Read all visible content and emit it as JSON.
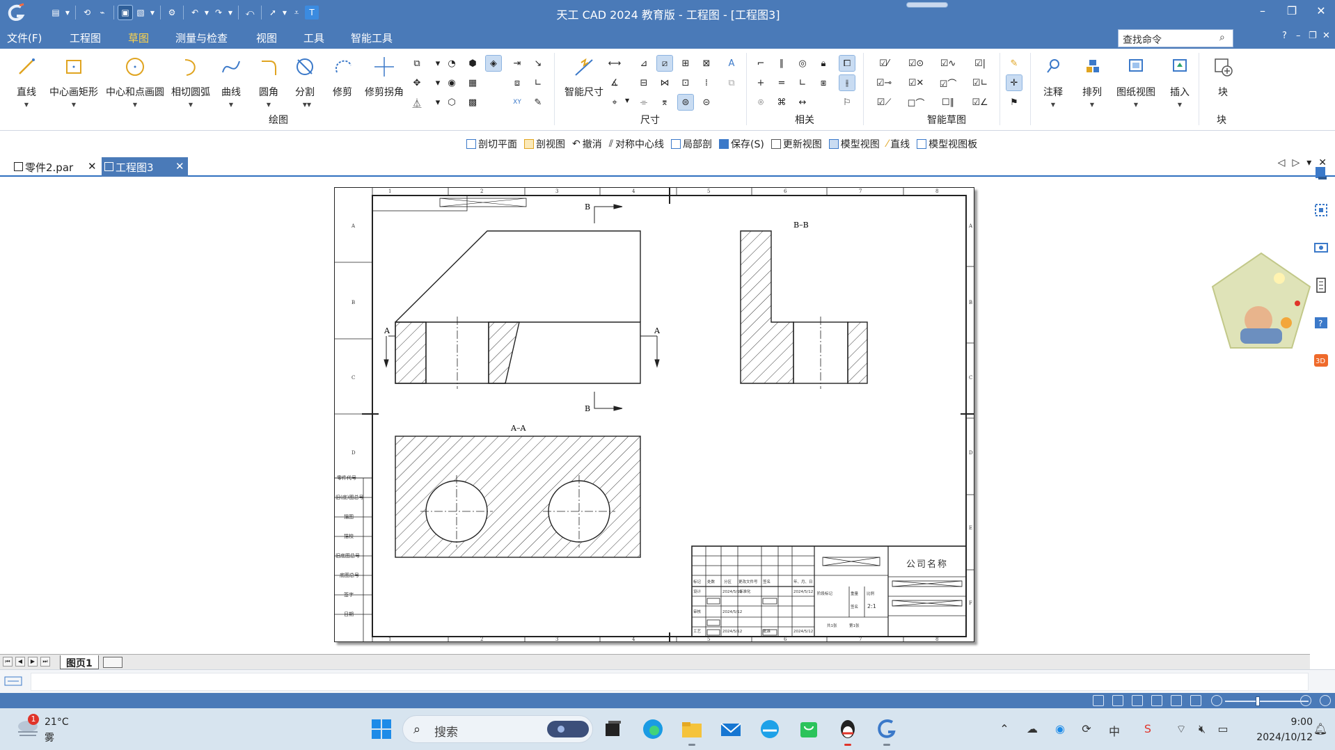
{
  "window": {
    "title": "天工 CAD 2024 教育版 - 工程图 - [工程图3]"
  },
  "menu": {
    "items": [
      "文件(F)",
      "工程图",
      "草图",
      "测量与检查",
      "视图",
      "工具",
      "智能工具"
    ],
    "active_index": 2,
    "search_placeholder": "查找命令",
    "help": "?"
  },
  "ribbon": {
    "draw_tools": [
      "直线",
      "中心画矩形",
      "中心和点画圆",
      "相切圆弧",
      "曲线",
      "圆角",
      "分割",
      "修剪",
      "修剪拐角"
    ],
    "groups": {
      "draw": "绘图",
      "dimension": "尺寸",
      "relate": "相关",
      "smart_sketch": "智能草图",
      "block": "块"
    },
    "smart_dimension": "智能尺寸",
    "annotation": "注释",
    "arrange": "排列",
    "drawing_view": "图纸视图",
    "insert": "插入",
    "block": "块"
  },
  "draw_toolbar": {
    "items": [
      "剖切平面",
      "剖视图",
      "撤消",
      "对称中心线",
      "局部剖",
      "保存(S)",
      "更新视图",
      "模型视图",
      "直线",
      "模型视图板"
    ]
  },
  "doc_tabs": {
    "tabs": [
      "零件2.par",
      "工程图3"
    ],
    "active_index": 1
  },
  "drawing": {
    "view_labels": {
      "section_bb": "B–B",
      "section_aa": "A–A",
      "cut_a": "A",
      "cut_b": "B"
    },
    "zones_top": [
      "1",
      "2",
      "3",
      "4",
      "5",
      "6",
      "7",
      "8"
    ],
    "zones_side": [
      "A",
      "B",
      "C",
      "D",
      "E",
      "F"
    ],
    "left_strip": [
      "零件代号",
      "旧(底)图总号",
      "描图",
      "描校",
      "旧底图总号",
      "底图总号",
      "签字",
      "日期"
    ],
    "title_block": {
      "company": "公司名称",
      "scale": "2:1",
      "headers": [
        "标记",
        "处数",
        "分区",
        "更改文件号",
        "签名",
        "年、月、日"
      ],
      "rows": [
        "设计",
        "审核",
        "工艺",
        "标准化",
        "批准"
      ],
      "date": "2024/5/12",
      "stage": "阶段标记",
      "weight": "重量",
      "ratio": "比例",
      "sheet_total": "共1张",
      "sheet_no": "第1张"
    }
  },
  "sheet_tabs": {
    "tabs": [
      "图页1"
    ]
  },
  "taskbar": {
    "weather_temp": "21°C",
    "weather_cond": "雾",
    "weather_badge": "1",
    "search_label": "搜索",
    "time": "9:00",
    "date": "2024/10/12",
    "ime": "中"
  },
  "colors": {
    "titlebar": "#4a7ab8",
    "active_menu": "#ffd54a",
    "tab_active": "#4a7ab8"
  }
}
